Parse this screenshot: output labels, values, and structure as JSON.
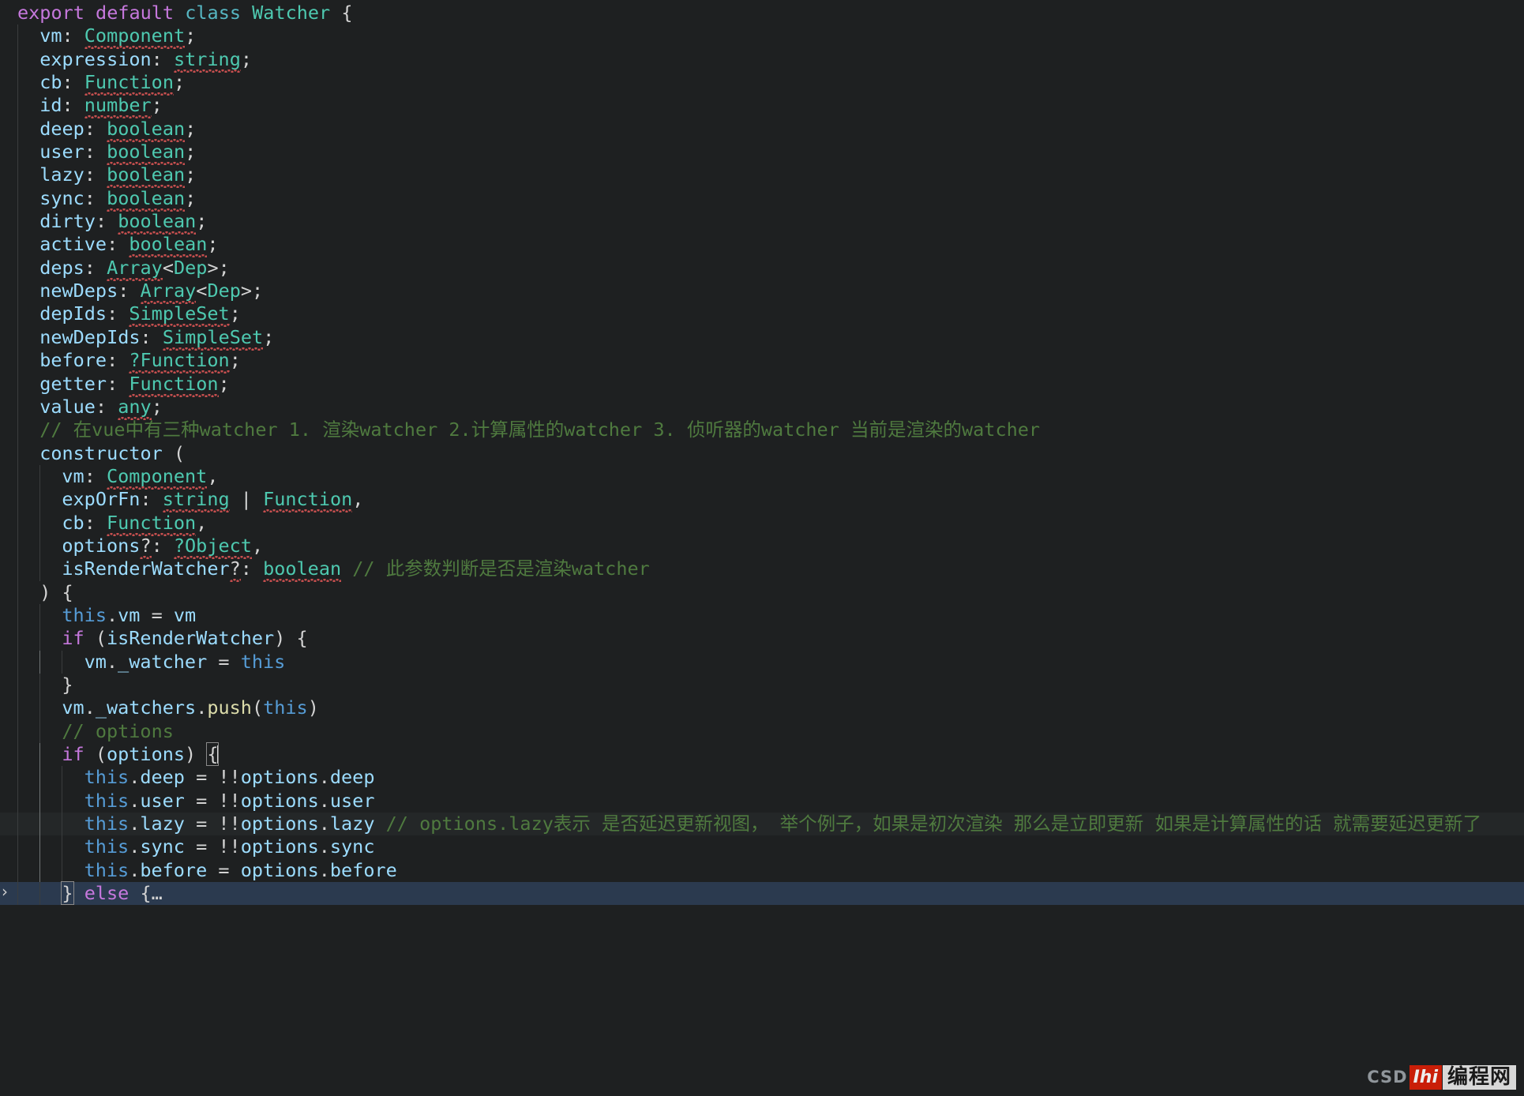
{
  "editor": {
    "language": "flow-javascript",
    "background": "#1e2021",
    "current_line_background": "#242728",
    "selection_background": "#2b3a4f",
    "font_size_px": 23.5,
    "line_height_px": 29.35,
    "cursor_line_index": 30,
    "cursor_token": "{",
    "fold_chevron": "›"
  },
  "colors": {
    "keyword": "#c678dd",
    "class_keyword": "#56b6c2",
    "type": "#4ec9b0",
    "property": "#9cdcfe",
    "comment": "#4f7a3f",
    "this_keyword": "#569cd6",
    "function_call": "#dcdcaa",
    "punctuation": "#d4d4d4",
    "squiggle": "#c64f4f",
    "indent_guide": "#3a3d3e",
    "indent_guide_active": "#707476"
  },
  "watermark": {
    "csd_text": "CSD",
    "mark_text": "Ihi",
    "cn_text": "编程网"
  },
  "code": {
    "lines": [
      {
        "indent": 0,
        "tokens": [
          {
            "t": "export",
            "c": "kw"
          },
          {
            "t": " ",
            "c": "punc"
          },
          {
            "t": "default",
            "c": "kw"
          },
          {
            "t": " ",
            "c": "punc"
          },
          {
            "t": "class",
            "c": "kw2"
          },
          {
            "t": " ",
            "c": "punc"
          },
          {
            "t": "Watcher",
            "c": "cls"
          },
          {
            "t": " {",
            "c": "punc"
          }
        ]
      },
      {
        "indent": 1,
        "tokens": [
          {
            "t": "vm",
            "c": "prop"
          },
          {
            "t": ": ",
            "c": "punc"
          },
          {
            "t": "Component",
            "c": "type",
            "sq": true
          },
          {
            "t": ";",
            "c": "punc"
          }
        ]
      },
      {
        "indent": 1,
        "tokens": [
          {
            "t": "expression",
            "c": "prop"
          },
          {
            "t": ": ",
            "c": "punc"
          },
          {
            "t": "string",
            "c": "type",
            "sq": true
          },
          {
            "t": ";",
            "c": "punc"
          }
        ]
      },
      {
        "indent": 1,
        "tokens": [
          {
            "t": "cb",
            "c": "prop"
          },
          {
            "t": ": ",
            "c": "punc"
          },
          {
            "t": "Function",
            "c": "type",
            "sq": true
          },
          {
            "t": ";",
            "c": "punc"
          }
        ]
      },
      {
        "indent": 1,
        "tokens": [
          {
            "t": "id",
            "c": "prop"
          },
          {
            "t": ": ",
            "c": "punc"
          },
          {
            "t": "number",
            "c": "type",
            "sq": true
          },
          {
            "t": ";",
            "c": "punc"
          }
        ]
      },
      {
        "indent": 1,
        "tokens": [
          {
            "t": "deep",
            "c": "prop"
          },
          {
            "t": ": ",
            "c": "punc"
          },
          {
            "t": "boolean",
            "c": "type",
            "sq": true
          },
          {
            "t": ";",
            "c": "punc"
          }
        ]
      },
      {
        "indent": 1,
        "tokens": [
          {
            "t": "user",
            "c": "prop"
          },
          {
            "t": ": ",
            "c": "punc"
          },
          {
            "t": "boolean",
            "c": "type",
            "sq": true
          },
          {
            "t": ";",
            "c": "punc"
          }
        ]
      },
      {
        "indent": 1,
        "tokens": [
          {
            "t": "lazy",
            "c": "prop"
          },
          {
            "t": ": ",
            "c": "punc"
          },
          {
            "t": "boolean",
            "c": "type",
            "sq": true
          },
          {
            "t": ";",
            "c": "punc"
          }
        ]
      },
      {
        "indent": 1,
        "tokens": [
          {
            "t": "sync",
            "c": "prop"
          },
          {
            "t": ": ",
            "c": "punc"
          },
          {
            "t": "boolean",
            "c": "type",
            "sq": true
          },
          {
            "t": ";",
            "c": "punc"
          }
        ]
      },
      {
        "indent": 1,
        "tokens": [
          {
            "t": "dirty",
            "c": "prop"
          },
          {
            "t": ": ",
            "c": "punc"
          },
          {
            "t": "boolean",
            "c": "type",
            "sq": true
          },
          {
            "t": ";",
            "c": "punc"
          }
        ]
      },
      {
        "indent": 1,
        "tokens": [
          {
            "t": "active",
            "c": "prop"
          },
          {
            "t": ": ",
            "c": "punc"
          },
          {
            "t": "boolean",
            "c": "type",
            "sq": true
          },
          {
            "t": ";",
            "c": "punc"
          }
        ]
      },
      {
        "indent": 1,
        "tokens": [
          {
            "t": "deps",
            "c": "prop"
          },
          {
            "t": ": ",
            "c": "punc"
          },
          {
            "t": "Array",
            "c": "type",
            "sq": true
          },
          {
            "t": "<",
            "c": "punc"
          },
          {
            "t": "Dep",
            "c": "type"
          },
          {
            "t": ">;",
            "c": "punc"
          }
        ]
      },
      {
        "indent": 1,
        "tokens": [
          {
            "t": "newDeps",
            "c": "prop"
          },
          {
            "t": ": ",
            "c": "punc"
          },
          {
            "t": "Array",
            "c": "type",
            "sq": true
          },
          {
            "t": "<",
            "c": "punc"
          },
          {
            "t": "Dep",
            "c": "type"
          },
          {
            "t": ">;",
            "c": "punc"
          }
        ]
      },
      {
        "indent": 1,
        "tokens": [
          {
            "t": "depIds",
            "c": "prop"
          },
          {
            "t": ": ",
            "c": "punc"
          },
          {
            "t": "SimpleSet",
            "c": "type",
            "sq": true
          },
          {
            "t": ";",
            "c": "punc"
          }
        ]
      },
      {
        "indent": 1,
        "tokens": [
          {
            "t": "newDepIds",
            "c": "prop"
          },
          {
            "t": ": ",
            "c": "punc"
          },
          {
            "t": "SimpleSet",
            "c": "type",
            "sq": true
          },
          {
            "t": ";",
            "c": "punc"
          }
        ]
      },
      {
        "indent": 1,
        "tokens": [
          {
            "t": "before",
            "c": "prop"
          },
          {
            "t": ": ",
            "c": "punc"
          },
          {
            "t": "?Function",
            "c": "type",
            "sq": true
          },
          {
            "t": ";",
            "c": "punc"
          }
        ]
      },
      {
        "indent": 1,
        "tokens": [
          {
            "t": "getter",
            "c": "prop"
          },
          {
            "t": ": ",
            "c": "punc"
          },
          {
            "t": "Function",
            "c": "type",
            "sq": true
          },
          {
            "t": ";",
            "c": "punc"
          }
        ]
      },
      {
        "indent": 1,
        "tokens": [
          {
            "t": "value",
            "c": "prop"
          },
          {
            "t": ": ",
            "c": "punc"
          },
          {
            "t": "any",
            "c": "type",
            "sq": true
          },
          {
            "t": ";",
            "c": "punc"
          }
        ]
      },
      {
        "indent": 1,
        "tokens": [
          {
            "t": "// 在vue中有三种watcher 1. 渲染watcher 2.计算属性的watcher 3. 侦听器的watcher 当前是渲染的watcher",
            "c": "cmt"
          }
        ]
      },
      {
        "indent": 1,
        "tokens": [
          {
            "t": "constructor",
            "c": "ctor"
          },
          {
            "t": " (",
            "c": "punc"
          }
        ]
      },
      {
        "indent": 2,
        "tokens": [
          {
            "t": "vm",
            "c": "prop"
          },
          {
            "t": ": ",
            "c": "punc"
          },
          {
            "t": "Component",
            "c": "type",
            "sq": true
          },
          {
            "t": ",",
            "c": "punc"
          }
        ]
      },
      {
        "indent": 2,
        "tokens": [
          {
            "t": "expOrFn",
            "c": "prop"
          },
          {
            "t": ": ",
            "c": "punc"
          },
          {
            "t": "string",
            "c": "type",
            "sq": true
          },
          {
            "t": " | ",
            "c": "punc"
          },
          {
            "t": "Function",
            "c": "type",
            "sq": true
          },
          {
            "t": ",",
            "c": "punc"
          }
        ]
      },
      {
        "indent": 2,
        "tokens": [
          {
            "t": "cb",
            "c": "prop"
          },
          {
            "t": ": ",
            "c": "punc"
          },
          {
            "t": "Function",
            "c": "type",
            "sq": true
          },
          {
            "t": ",",
            "c": "punc"
          }
        ]
      },
      {
        "indent": 2,
        "tokens": [
          {
            "t": "options",
            "c": "prop"
          },
          {
            "t": "?",
            "c": "punc",
            "sq": true
          },
          {
            "t": ": ",
            "c": "punc"
          },
          {
            "t": "?Object",
            "c": "type",
            "sq": true
          },
          {
            "t": ",",
            "c": "punc"
          }
        ]
      },
      {
        "indent": 2,
        "tokens": [
          {
            "t": "isRenderWatcher",
            "c": "prop"
          },
          {
            "t": "?",
            "c": "punc",
            "sq": true
          },
          {
            "t": ": ",
            "c": "punc"
          },
          {
            "t": "boolean",
            "c": "type",
            "sq": true
          },
          {
            "t": " ",
            "c": "punc"
          },
          {
            "t": "// 此参数判断是否是渲染watcher",
            "c": "cmt"
          }
        ]
      },
      {
        "indent": 1,
        "tokens": [
          {
            "t": ") {",
            "c": "punc"
          }
        ]
      },
      {
        "indent": 2,
        "tokens": [
          {
            "t": "this",
            "c": "this"
          },
          {
            "t": ".",
            "c": "punc"
          },
          {
            "t": "vm",
            "c": "prop"
          },
          {
            "t": " = ",
            "c": "punc"
          },
          {
            "t": "vm",
            "c": "prop"
          }
        ]
      },
      {
        "indent": 2,
        "tokens": [
          {
            "t": "if",
            "c": "kw"
          },
          {
            "t": " (",
            "c": "punc"
          },
          {
            "t": "isRenderWatcher",
            "c": "prop"
          },
          {
            "t": ") {",
            "c": "punc"
          }
        ]
      },
      {
        "indent": 3,
        "tokens": [
          {
            "t": "vm",
            "c": "prop"
          },
          {
            "t": ".",
            "c": "punc"
          },
          {
            "t": "_watcher",
            "c": "prop"
          },
          {
            "t": " = ",
            "c": "punc"
          },
          {
            "t": "this",
            "c": "this"
          }
        ]
      },
      {
        "indent": 2,
        "tokens": [
          {
            "t": "}",
            "c": "punc"
          }
        ]
      },
      {
        "indent": 2,
        "tokens": [
          {
            "t": "vm",
            "c": "prop"
          },
          {
            "t": ".",
            "c": "punc"
          },
          {
            "t": "_watchers",
            "c": "prop"
          },
          {
            "t": ".",
            "c": "punc"
          },
          {
            "t": "push",
            "c": "fn"
          },
          {
            "t": "(",
            "c": "punc"
          },
          {
            "t": "this",
            "c": "this"
          },
          {
            "t": ")",
            "c": "punc"
          }
        ]
      },
      {
        "indent": 2,
        "tokens": [
          {
            "t": "// options",
            "c": "cmt"
          }
        ]
      },
      {
        "indent": 2,
        "cursor": true,
        "tokens": [
          {
            "t": "if",
            "c": "kw"
          },
          {
            "t": " (",
            "c": "punc"
          },
          {
            "t": "options",
            "c": "prop"
          },
          {
            "t": ") ",
            "c": "punc"
          },
          {
            "t": "{",
            "c": "punc",
            "bracket": true
          }
        ]
      },
      {
        "indent": 3,
        "tokens": [
          {
            "t": "this",
            "c": "this"
          },
          {
            "t": ".",
            "c": "punc"
          },
          {
            "t": "deep",
            "c": "prop"
          },
          {
            "t": " = !!",
            "c": "punc"
          },
          {
            "t": "options",
            "c": "prop"
          },
          {
            "t": ".",
            "c": "punc"
          },
          {
            "t": "deep",
            "c": "prop"
          }
        ]
      },
      {
        "indent": 3,
        "tokens": [
          {
            "t": "this",
            "c": "this"
          },
          {
            "t": ".",
            "c": "punc"
          },
          {
            "t": "user",
            "c": "prop"
          },
          {
            "t": " = !!",
            "c": "punc"
          },
          {
            "t": "options",
            "c": "prop"
          },
          {
            "t": ".",
            "c": "punc"
          },
          {
            "t": "user",
            "c": "prop"
          }
        ]
      },
      {
        "indent": 3,
        "highlight": true,
        "tokens": [
          {
            "t": "this",
            "c": "this"
          },
          {
            "t": ".",
            "c": "punc"
          },
          {
            "t": "lazy",
            "c": "prop"
          },
          {
            "t": " = !!",
            "c": "punc"
          },
          {
            "t": "options",
            "c": "prop"
          },
          {
            "t": ".",
            "c": "punc"
          },
          {
            "t": "lazy",
            "c": "prop"
          },
          {
            "t": " ",
            "c": "punc"
          },
          {
            "t": "// options.lazy表示 是否延迟更新视图， 举个例子，如果是初次渲染 那么是立即更新 如果是计算属性的话 就需要延迟更新了",
            "c": "cmt"
          }
        ]
      },
      {
        "indent": 3,
        "tokens": [
          {
            "t": "this",
            "c": "this"
          },
          {
            "t": ".",
            "c": "punc"
          },
          {
            "t": "sync",
            "c": "prop"
          },
          {
            "t": " = !!",
            "c": "punc"
          },
          {
            "t": "options",
            "c": "prop"
          },
          {
            "t": ".",
            "c": "punc"
          },
          {
            "t": "sync",
            "c": "prop"
          }
        ]
      },
      {
        "indent": 3,
        "tokens": [
          {
            "t": "this",
            "c": "this"
          },
          {
            "t": ".",
            "c": "punc"
          },
          {
            "t": "before",
            "c": "prop"
          },
          {
            "t": " = ",
            "c": "punc"
          },
          {
            "t": "options",
            "c": "prop"
          },
          {
            "t": ".",
            "c": "punc"
          },
          {
            "t": "before",
            "c": "prop"
          }
        ]
      },
      {
        "indent": 2,
        "selected": true,
        "chevron": true,
        "tokens": [
          {
            "t": "}",
            "c": "punc",
            "bracket": true
          },
          {
            "t": " ",
            "c": "punc"
          },
          {
            "t": "else",
            "c": "kw"
          },
          {
            "t": " {",
            "c": "punc"
          },
          {
            "t": "…",
            "c": "punc"
          }
        ]
      }
    ]
  }
}
